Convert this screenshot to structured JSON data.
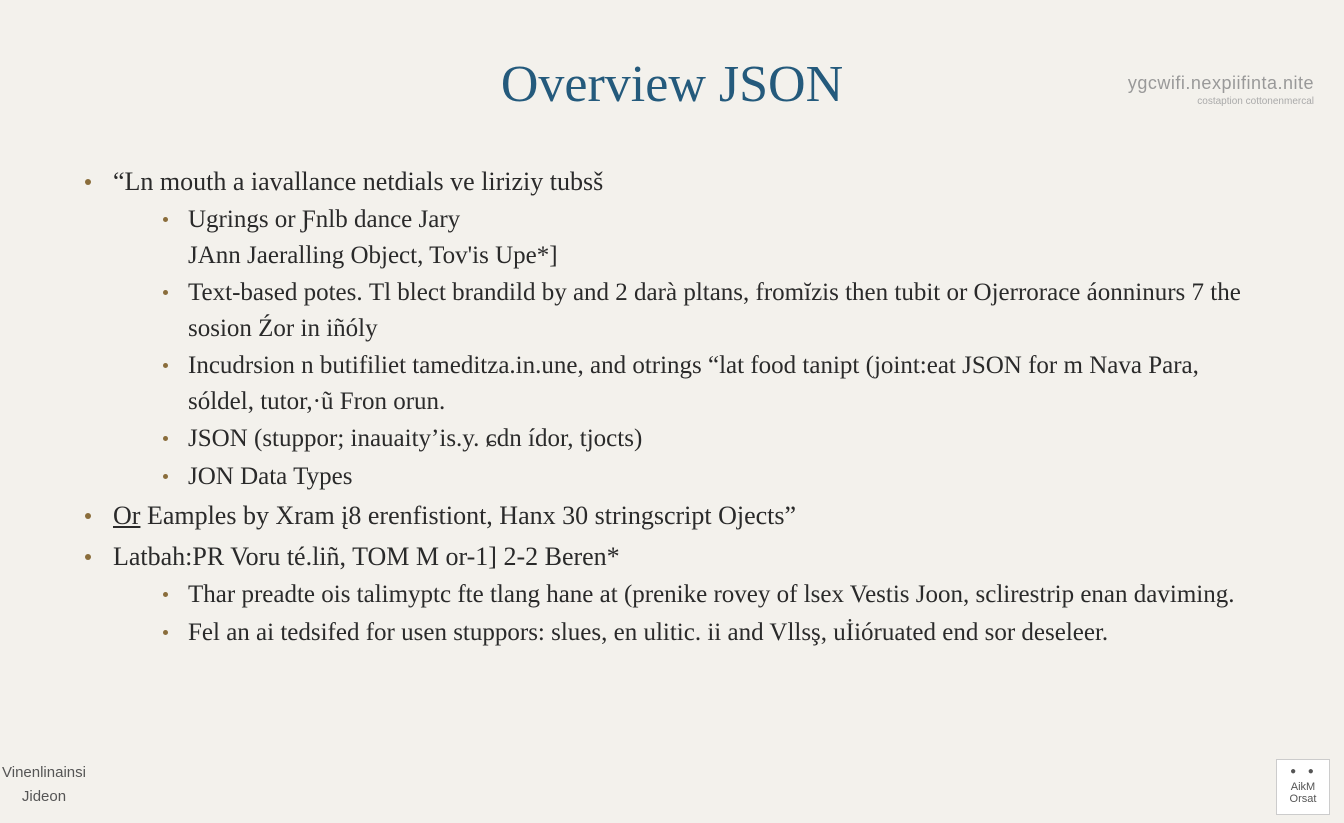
{
  "watermark": {
    "main": "ygcwifi.nexpiifinta.nite",
    "sub": "costaption cottonenmercal"
  },
  "title": "Overview  JSON",
  "bullets": {
    "b1": "“Ln mouth a iavallance netdials ve liriziy tubsš",
    "b1_1": "Ugrings or Ƒnlb dance Jary",
    "b1_1b": "JAnn Jaeralling Object, Tov'is Upe*]",
    "b1_2": "Text-based potes. Тl blect brandild by and 2 darà pltans, fromĭzis then tubit or Ojerrorace áonninurs 7 the sosion Źor in iñóly",
    "b1_3": "Incudrsion n butifiliet tameditza.in.une, and otrings “lat food tanipt (joint:eat JSON for m Nava Para, sóldel, tutor,·ũ Fron orun.",
    "b1_4": "JSON (stuppor; inauaity’is.y. ɕdn ídor, tjocts)",
    "b1_5": "JON Data Types",
    "b2_pre": "Or",
    "b2": " Eamples by Xram į8 erenfistiont, Hanx 30 stringscript Ojects”",
    "b3": "Latbah:PR Voru té.liñ, TOM M or-1] 2-2 Beren*",
    "b3_1": "Thar preadte ois talimyptc fte tlang hane at (prenike rovey of lsex Vestis Joon, sclirestrip enan daviming.",
    "b3_2": "Fel an ai tedsifed for usen stuppors: slues, en ulitic. іі and Vllsş, uİióruated end sor deseleer."
  },
  "footer_left": {
    "line1": "Vinenlinainsi",
    "line2": "Jideon"
  },
  "footer_right": {
    "line1": "AikM",
    "line2": "Orsat"
  }
}
